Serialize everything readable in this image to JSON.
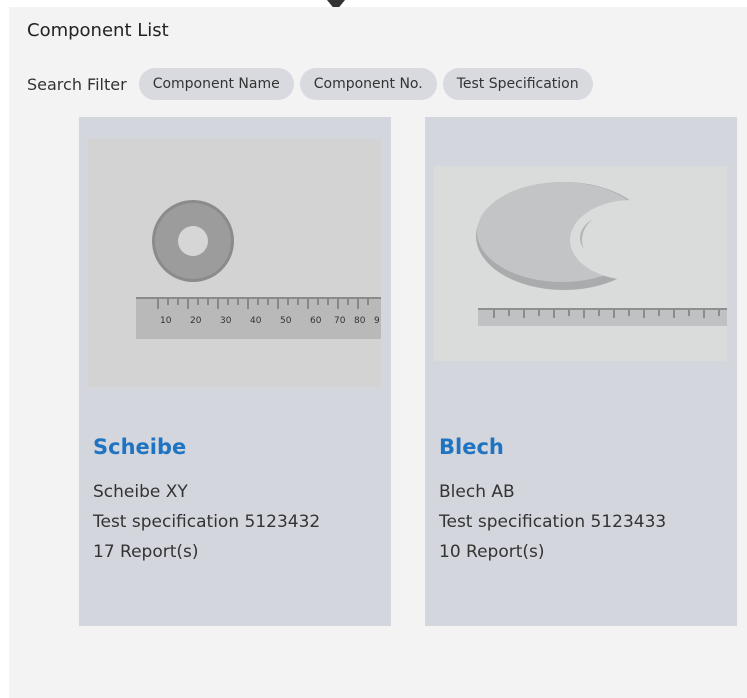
{
  "header": {
    "title": "Component List",
    "filter_label": "Search Filter",
    "filters": [
      "Component Name",
      "Component No.",
      "Test Specification"
    ]
  },
  "cards": [
    {
      "name": "Scheibe",
      "subtitle": "Scheibe XY",
      "spec": "Test specification 5123432",
      "reports": "17 Report(s)",
      "ruler_marks": [
        "10",
        "20",
        "30",
        "40",
        "50",
        "60",
        "70",
        "80",
        "9"
      ]
    },
    {
      "name": "Blech",
      "subtitle": "Blech AB",
      "spec": "Test specification 5123433",
      "reports": "10 Report(s)"
    }
  ],
  "colors": {
    "accent": "#1f74c2",
    "card_bg": "#d4d6dd",
    "chip_bg": "#d8dadf",
    "panel_bg": "#f3f3f3"
  }
}
